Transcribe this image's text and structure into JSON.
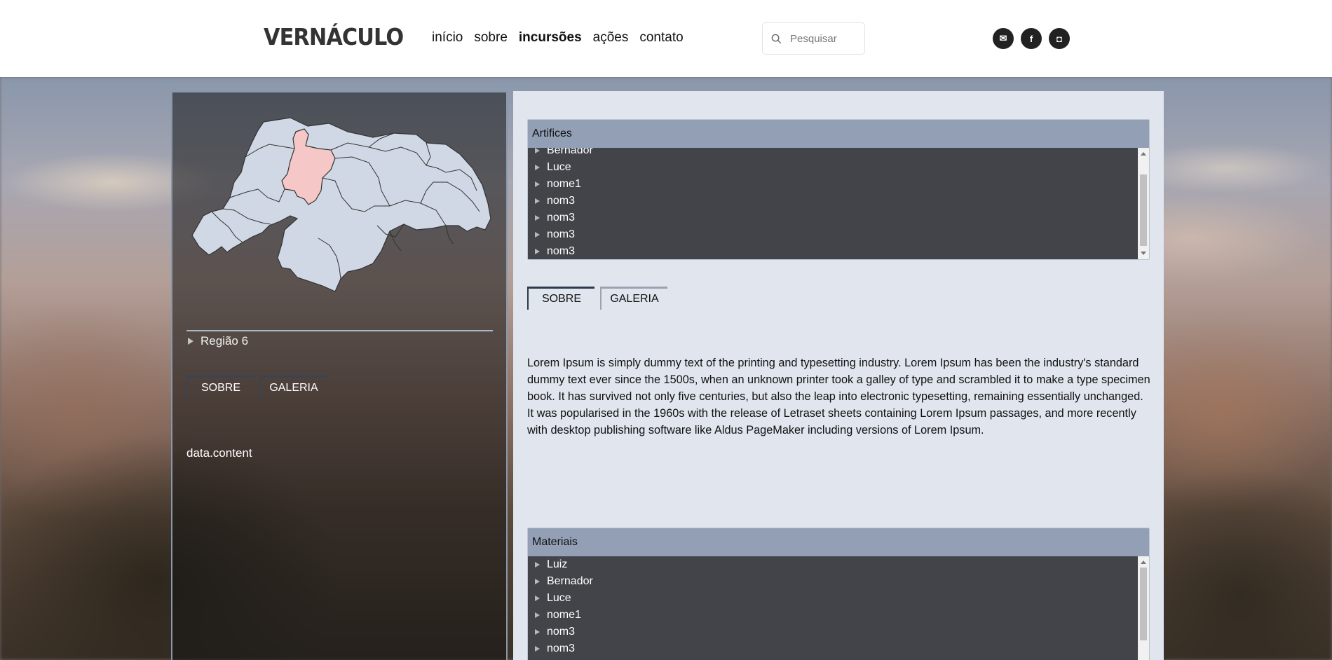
{
  "header": {
    "logo": "VERNÁCULO",
    "nav": [
      {
        "label": "início"
      },
      {
        "label": "sobre"
      },
      {
        "label": "incursões",
        "active": true
      },
      {
        "label": "ações"
      },
      {
        "label": "contato"
      }
    ],
    "search": {
      "placeholder": "Pesquisar"
    },
    "social": [
      {
        "icon": "mail-icon",
        "glyph": "✉"
      },
      {
        "icon": "facebook-icon",
        "glyph": "f"
      },
      {
        "icon": "instagram-icon",
        "glyph": "◘"
      }
    ]
  },
  "left_panel": {
    "map": {
      "highlight_color": "#f5c7c7",
      "base_color": "#cfd8e4",
      "stroke_color": "#333333"
    },
    "region_label": "Região 6",
    "tabs": [
      {
        "label": "SOBRE"
      },
      {
        "label": "GALERIA"
      }
    ],
    "content": "data.content"
  },
  "right_panel": {
    "artifices": {
      "title": "Artifices",
      "items": [
        "Bernador",
        "Luce",
        "nome1",
        "nom3",
        "nom3",
        "nom3",
        "nom3"
      ]
    },
    "tabs": [
      {
        "label": "SOBRE",
        "active": true
      },
      {
        "label": "GALERIA"
      }
    ],
    "paragraph": "Lorem Ipsum is simply dummy text of the printing and typesetting industry. Lorem Ipsum has been the industry's standard dummy text ever since the 1500s, when an unknown printer took a galley of type and scrambled it to make a type specimen book. It has survived not only five centuries, but also the leap into electronic typesetting, remaining essentially unchanged. It was popularised in the 1960s with the release of Letraset sheets containing Lorem Ipsum passages, and more recently with desktop publishing software like Aldus PageMaker including versions of Lorem Ipsum.",
    "materiais": {
      "title": "Materiais",
      "items": [
        "Luiz",
        "Bernador",
        "Luce",
        "nome1",
        "nom3",
        "nom3"
      ]
    }
  },
  "colors": {
    "header_bg": "#ffffff",
    "list_head": "#929fb5",
    "list_body": "#434449",
    "panel_light": "#e0e5ee"
  }
}
